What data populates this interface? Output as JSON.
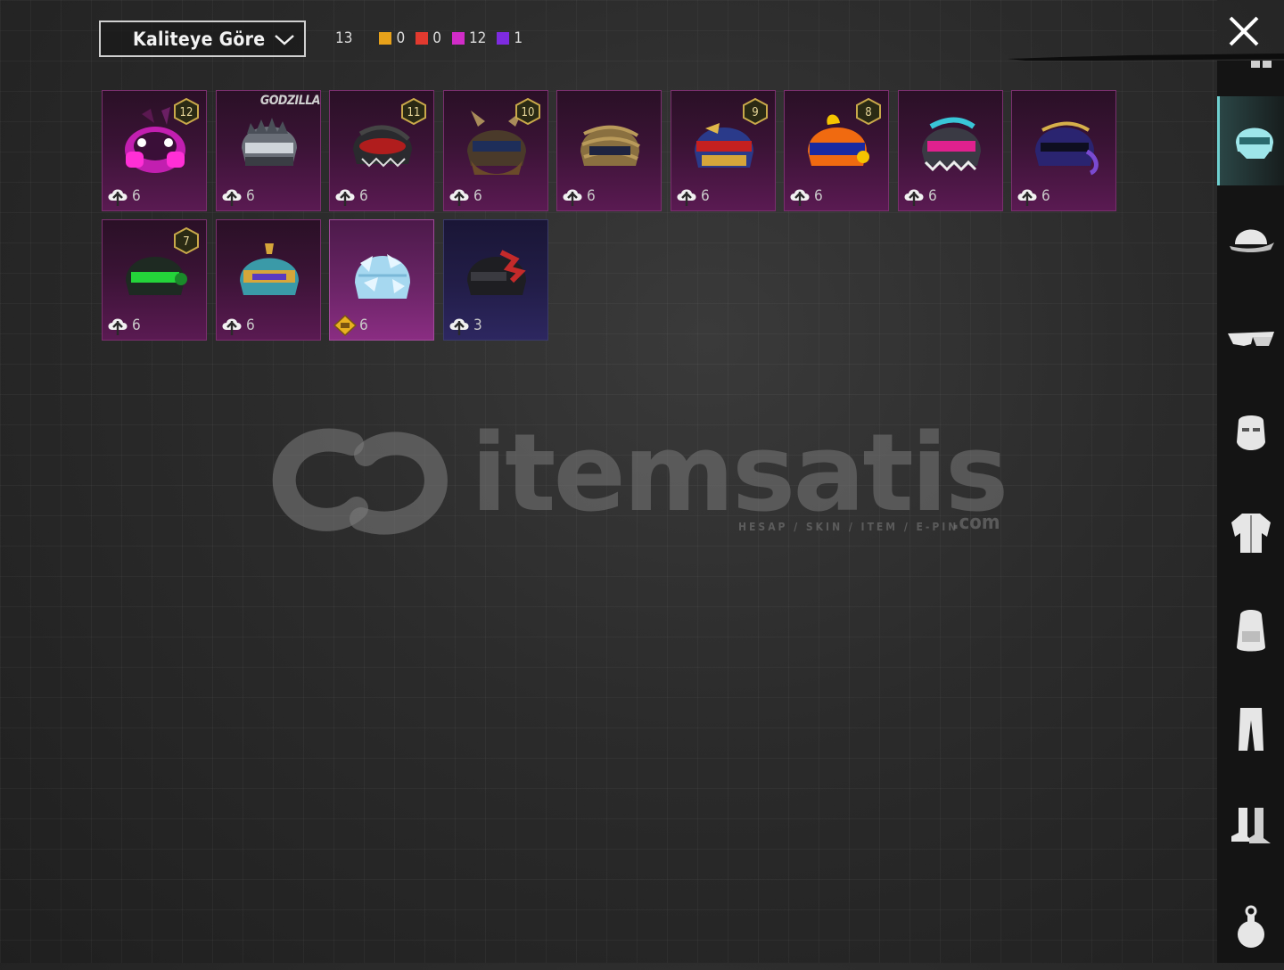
{
  "sort": {
    "label": "Kaliteye Göre"
  },
  "counts": {
    "total": "13",
    "tiers": [
      {
        "value": "0",
        "color": "#e8a21a"
      },
      {
        "value": "0",
        "color": "#e23a2f"
      },
      {
        "value": "12",
        "color": "#d12cc8"
      },
      {
        "value": "1",
        "color": "#7e2be0"
      }
    ]
  },
  "items": [
    {
      "name": "pink mecha bunny helmet",
      "level": "12",
      "count": "6",
      "tier": "epic",
      "icon": "upgrade-icon"
    },
    {
      "name": "godzilla helmet",
      "brand": "GODZILLA",
      "count": "6",
      "tier": "epic",
      "icon": "upgrade-icon"
    },
    {
      "name": "black red dragon helmet",
      "level": "11",
      "count": "6",
      "tier": "epic",
      "icon": "upgrade-icon"
    },
    {
      "name": "horned viking helmet",
      "level": "10",
      "count": "6",
      "tier": "epic",
      "icon": "upgrade-icon"
    },
    {
      "name": "golden serpent helmet",
      "count": "6",
      "tier": "epic",
      "icon": "upgrade-icon"
    },
    {
      "name": "red blue royal helmet",
      "level": "9",
      "count": "6",
      "tier": "epic",
      "icon": "upgrade-icon"
    },
    {
      "name": "orange koi helmet",
      "level": "8",
      "count": "6",
      "tier": "epic",
      "icon": "upgrade-icon"
    },
    {
      "name": "pink maid helmet",
      "count": "6",
      "tier": "epic",
      "icon": "upgrade-icon"
    },
    {
      "name": "purple gold knight helmet",
      "count": "6",
      "tier": "epic",
      "icon": "upgrade-icon"
    },
    {
      "name": "green tech helmet",
      "level": "7",
      "count": "6",
      "tier": "epic",
      "icon": "upgrade-icon"
    },
    {
      "name": "teal gold helmet",
      "count": "6",
      "tier": "epic",
      "icon": "upgrade-icon"
    },
    {
      "name": "ice crystal helmet",
      "count": "6",
      "tier": "legendary",
      "icon": "diamond-icon"
    },
    {
      "name": "black red tiger helmet",
      "count": "3",
      "tier": "mythic",
      "icon": "upgrade-icon"
    }
  ],
  "watermark": {
    "brand": "itemsatis",
    "sub": "HESAP / SKIN / ITEM / E-PIN",
    "domain": ".com"
  },
  "sidebar": [
    "helmet-icon",
    "cap-icon",
    "glasses-icon",
    "mask-icon",
    "jacket-icon",
    "backpack-icon",
    "pants-icon",
    "boots-icon",
    "grenade-icon"
  ]
}
